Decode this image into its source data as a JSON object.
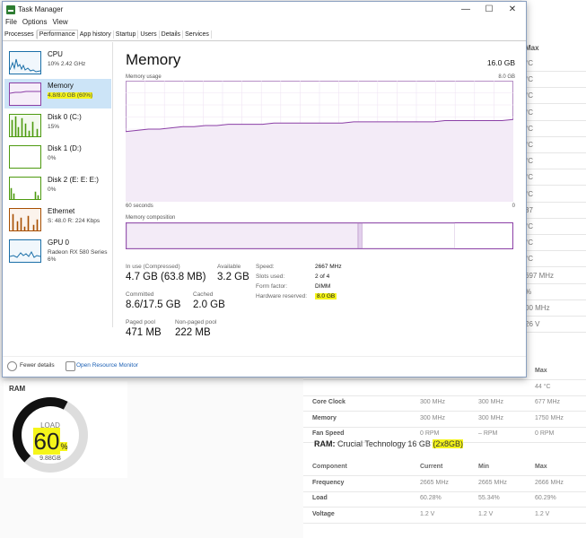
{
  "window": {
    "title": "Task Manager",
    "menu": [
      "File",
      "Options",
      "View"
    ],
    "tabs": [
      "Processes",
      "Performance",
      "App history",
      "Startup",
      "Users",
      "Details",
      "Services"
    ],
    "active_tab": "Performance",
    "controls": {
      "minimize": "—",
      "maximize": "☐",
      "close": "✕"
    }
  },
  "sidebar": {
    "items": [
      {
        "name": "CPU",
        "value": "10% 2.42 GHz",
        "value2": "",
        "color": "#1b6fa8"
      },
      {
        "name": "Memory",
        "value": "4.8/8.0 GB (60%)",
        "value2": "",
        "color": "#8b3fa6"
      },
      {
        "name": "Disk 0 (C:)",
        "value": "15%",
        "value2": "",
        "color": "#4d9a0f"
      },
      {
        "name": "Disk 1 (D:)",
        "value": "0%",
        "value2": "",
        "color": "#4d9a0f"
      },
      {
        "name": "Disk 2 (E: E: E:)",
        "value": "0%",
        "value2": "",
        "color": "#4d9a0f"
      },
      {
        "name": "Ethernet",
        "value": "S: 48.0  R: 224 Kbps",
        "value2": "",
        "color": "#a74f01"
      },
      {
        "name": "GPU 0",
        "value": "Radeon RX 580 Series",
        "value2": "6%",
        "color": "#1b6fa8"
      }
    ]
  },
  "main": {
    "title": "Memory",
    "total": "16.0 GB",
    "usage_label": "Memory usage",
    "usage_max": "8.0 GB",
    "axis_left": "60 seconds",
    "axis_right": "0",
    "composition_label": "Memory composition",
    "usage_line": [
      0.58,
      0.59,
      0.6,
      0.6,
      0.61,
      0.62,
      0.62,
      0.63,
      0.63,
      0.64,
      0.64,
      0.64,
      0.64,
      0.65,
      0.65,
      0.65,
      0.65,
      0.65,
      0.65,
      0.65,
      0.66,
      0.66,
      0.66,
      0.66,
      0.66,
      0.66,
      0.66,
      0.66,
      0.67,
      0.67,
      0.67,
      0.67,
      0.67,
      0.67,
      0.68
    ],
    "composition": {
      "in_use": 0.6,
      "modified": 0.01,
      "standby": 0.24,
      "free": 0.15
    },
    "stats": {
      "in_use_label": "In use (Compressed)",
      "in_use_value": "4.7 GB (63.8 MB)",
      "available_label": "Available",
      "available_value": "3.2 GB",
      "committed_label": "Committed",
      "committed_value": "8.6/17.5 GB",
      "cached_label": "Cached",
      "cached_value": "2.0 GB",
      "paged_label": "Paged pool",
      "paged_value": "471 MB",
      "nonpaged_label": "Non-paged pool",
      "nonpaged_value": "222 MB"
    },
    "details": [
      {
        "k": "Speed:",
        "v": "2667 MHz"
      },
      {
        "k": "Slots used:",
        "v": "2 of 4"
      },
      {
        "k": "Form factor:",
        "v": "DIMM"
      },
      {
        "k": "Hardware reserved:",
        "v": "8.0 GB"
      }
    ]
  },
  "footer": {
    "fewer": "Fewer details",
    "monitor": "Open Resource Monitor"
  },
  "background": {
    "col_header": "Max",
    "col_values": [
      "°C",
      "°C",
      "°C",
      "°C",
      "°C",
      "°C",
      "°C",
      "°C",
      "°C",
      "37",
      "°C",
      "°C",
      "°C",
      "697 MHz",
      "%",
      "00 MHz",
      "26 V"
    ],
    "gpu_rows": [
      {
        "c0": "",
        "c1": "",
        "c2": "",
        "c3": "Max"
      },
      {
        "c0": "",
        "c1": "",
        "c2": "",
        "c3": "44 °C"
      },
      {
        "c0": "Core Clock",
        "c1": "300 MHz",
        "c2": "300 MHz",
        "c3": "677 MHz"
      },
      {
        "c0": "Memory",
        "c1": "300 MHz",
        "c2": "300 MHz",
        "c3": "1750 MHz"
      },
      {
        "c0": "Fan Speed",
        "c1": "0 RPM",
        "c2": "– RPM",
        "c3": "0 RPM"
      }
    ],
    "ram_title_prefix": "RAM:",
    "ram_title_name": "Crucial Technology 16 GB",
    "ram_title_config": "(2x8GB)",
    "ram_rows": [
      {
        "c0": "Component",
        "c1": "Current",
        "c2": "Min",
        "c3": "Max"
      },
      {
        "c0": "Frequency",
        "c1": "2665 MHz",
        "c2": "2665 MHz",
        "c3": "2666 MHz"
      },
      {
        "c0": "Load",
        "c1": "60.28%",
        "c2": "55.34%",
        "c3": "60.29%"
      },
      {
        "c0": "Voltage",
        "c1": "1.2 V",
        "c2": "1.2 V",
        "c3": "1.2 V"
      }
    ],
    "ram_card": {
      "label": "RAM",
      "load_label": "LOAD",
      "pct": "60",
      "unit": "%",
      "sub": "9.88GB",
      "fraction": 0.6
    }
  }
}
